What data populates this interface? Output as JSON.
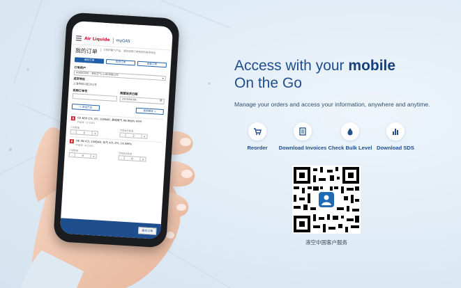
{
  "colors": {
    "brand_blue": "#1f4e8c",
    "accent_red": "#c8102e",
    "background": "#e6f0f8"
  },
  "phone_app": {
    "brand": "Air Liquide",
    "app_name": "myGAS",
    "page_title": "我的订单",
    "page_desc": "订购的氧气产品，请您选择订单和您的收货地址",
    "tabs": [
      "新的订单",
      "历史订单",
      "查看订单"
    ],
    "fields": {
      "account_label": "订单用户",
      "account_value": "A0000000 - 液化空气(上海)有限公司",
      "address_label": "送货地址",
      "address_value": "上海市虹口区201号",
      "po_label": "采购订单号",
      "date_label": "期望送货日期",
      "date_value": "2019/04/09"
    },
    "buttons": {
      "add_product": "+ 添加产品",
      "find_template": "使用模板 +",
      "submit": "提交订单"
    },
    "products": [
      {
        "name": "O2 N50 CYL 47L 150BAR, 高纯氧气 99.999% 47升",
        "code": "产品号: 1C1001",
        "qty_label": "订货数量",
        "qty_value": "2",
        "ret_label": "空瓶返还数量",
        "ret_value": "2"
      },
      {
        "name": "HE 5N 47L 150BAR, 氦气 47L CYL 14.5MPa",
        "code": "产品号: 4C1001",
        "qty_label": "订货数量",
        "qty_value": "0",
        "ret_label": "空瓶返还数量",
        "ret_value": "0"
      }
    ]
  },
  "hero": {
    "title_prefix": "Access with your ",
    "title_bold": "mobile",
    "title_line2": "On the Go",
    "subtitle": "Manage your orders and access your information, anywhere and anytime."
  },
  "features": [
    {
      "label": "Reorder",
      "icon": "cart-icon"
    },
    {
      "label": "Download Invoices",
      "icon": "invoice-icon"
    },
    {
      "label": "Check Bulk Level",
      "icon": "drop-icon"
    },
    {
      "label": "Download SDS",
      "icon": "bar-chart-icon"
    }
  ],
  "qr": {
    "caption": "液空中国客户服务"
  }
}
